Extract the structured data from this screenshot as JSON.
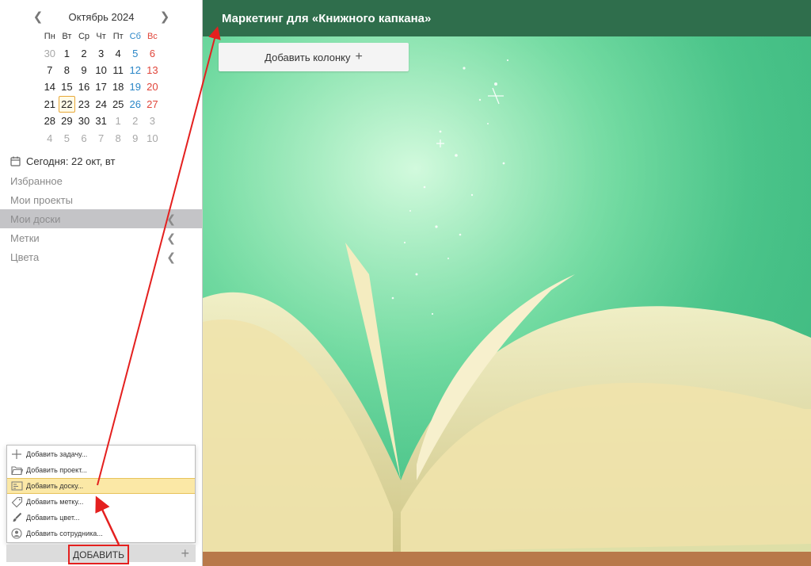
{
  "calendar": {
    "title": "Октябрь 2024",
    "weekdays": [
      "Пн",
      "Вт",
      "Ср",
      "Чт",
      "Пт",
      "Сб",
      "Вс"
    ],
    "weeks": [
      [
        "30",
        "1",
        "2",
        "3",
        "4",
        "5",
        "6"
      ],
      [
        "7",
        "8",
        "9",
        "10",
        "11",
        "12",
        "13"
      ],
      [
        "14",
        "15",
        "16",
        "17",
        "18",
        "19",
        "20"
      ],
      [
        "21",
        "22",
        "23",
        "24",
        "25",
        "26",
        "27"
      ],
      [
        "28",
        "29",
        "30",
        "31",
        "1",
        "2",
        "3"
      ],
      [
        "4",
        "5",
        "6",
        "7",
        "8",
        "9",
        "10"
      ]
    ],
    "selected_day": "22"
  },
  "sidebar": {
    "today_label": "Сегодня: 22 окт, вт",
    "items": [
      {
        "label": "Избранное"
      },
      {
        "label": "Мои проекты"
      },
      {
        "label": "Мои доски"
      },
      {
        "label": "Метки"
      },
      {
        "label": "Цвета"
      }
    ]
  },
  "add_menu": {
    "items": [
      {
        "label": "Добавить задачу...",
        "icon": "plus-icon"
      },
      {
        "label": "Добавить проект...",
        "icon": "folder-icon"
      },
      {
        "label": "Добавить доску...",
        "icon": "board-icon"
      },
      {
        "label": "Добавить метку...",
        "icon": "tag-icon"
      },
      {
        "label": "Добавить цвет...",
        "icon": "brush-icon"
      },
      {
        "label": "Добавить сотрудника...",
        "icon": "user-icon"
      }
    ],
    "button_label": "ДОБАВИТЬ"
  },
  "board": {
    "title": "Маркетинг для «Книжного капкана»",
    "add_column_label": "Добавить колонку"
  },
  "colors": {
    "header_bg": "#2f6e4c",
    "highlight": "#fbe8a6",
    "annotation": "#e4201f"
  }
}
